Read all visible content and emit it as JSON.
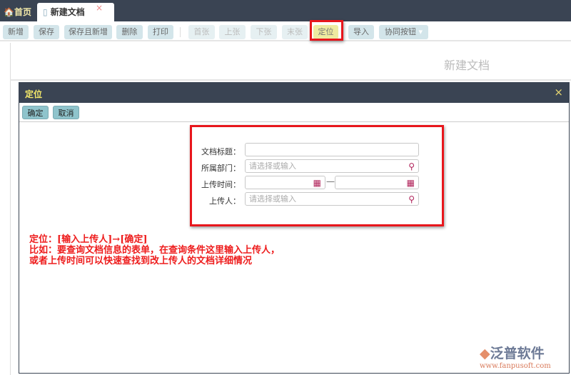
{
  "tabs": {
    "home": "首页",
    "current": "新建文档",
    "close": "×"
  },
  "toolbar": {
    "buttons": [
      "新增",
      "保存",
      "保存且新增",
      "删除",
      "打印",
      "首张",
      "上张",
      "下张",
      "末张",
      "定位",
      "导入",
      "协同按钮"
    ]
  },
  "page_title": "新建文档",
  "dialog": {
    "title": "定位",
    "close": "×",
    "ok": "确定",
    "cancel": "取消",
    "fields": [
      {
        "label": "文档标题：",
        "placeholder": ""
      },
      {
        "label": "所属部门：",
        "placeholder": "请选择或输入"
      },
      {
        "label": "上传时间：",
        "placeholder": "",
        "separator": "—"
      },
      {
        "label": "上传人：",
        "placeholder": "请选择或输入"
      }
    ]
  },
  "annotation": [
    "定位：[输入上传人]→[确定]",
    "比如：要查询文档信息的表单，在查询条件这里输入上传人，",
    "或者上传时间可以快速查找到改上传人的文档详细情况"
  ],
  "logo": {
    "name": "泛普软件",
    "url": "www.fanpusoft.com"
  }
}
